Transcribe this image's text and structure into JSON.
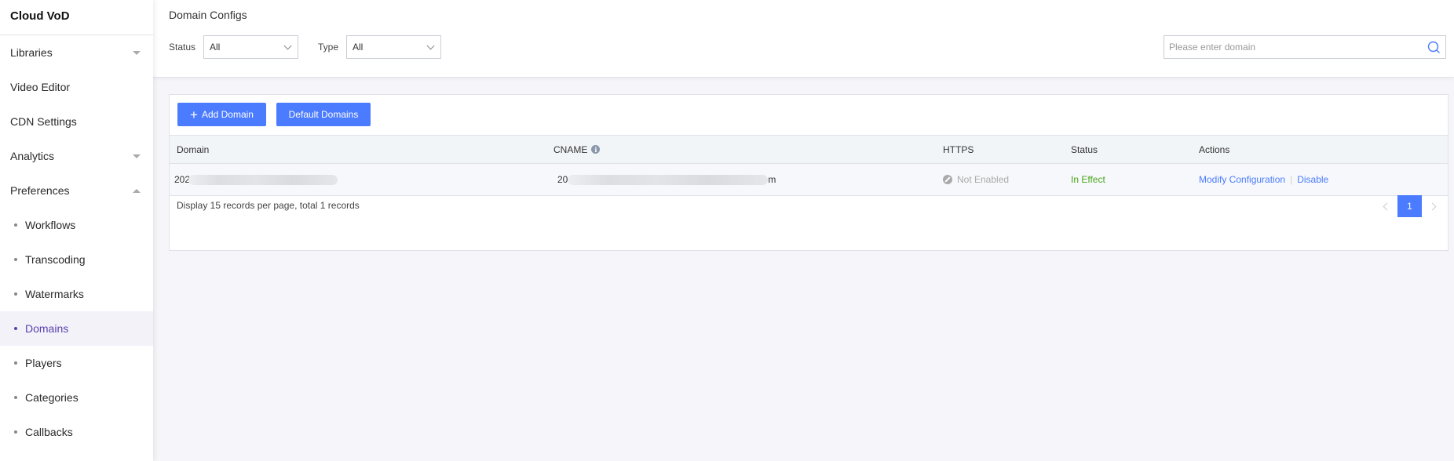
{
  "app": {
    "title": "Cloud VoD"
  },
  "sidebar": {
    "items": [
      {
        "label": "Libraries",
        "caret": "down"
      },
      {
        "label": "Video Editor"
      },
      {
        "label": "CDN Settings"
      },
      {
        "label": "Analytics",
        "caret": "down"
      },
      {
        "label": "Preferences",
        "caret": "up"
      }
    ],
    "sub_items": [
      {
        "label": "Workflows"
      },
      {
        "label": "Transcoding"
      },
      {
        "label": "Watermarks"
      },
      {
        "label": "Domains",
        "active": true
      },
      {
        "label": "Players"
      },
      {
        "label": "Categories"
      },
      {
        "label": "Callbacks"
      }
    ]
  },
  "header": {
    "title": "Domain Configs",
    "filters": {
      "status_label": "Status",
      "status_value": "All",
      "type_label": "Type",
      "type_value": "All"
    },
    "search": {
      "placeholder": "Please enter domain",
      "value": ""
    }
  },
  "toolbar": {
    "add_domain_icon": "plus-icon",
    "add_domain_label": "Add Domain",
    "default_domains_label": "Default Domains"
  },
  "table": {
    "columns": [
      "Domain",
      "CNAME",
      "HTTPS",
      "Status",
      "Actions"
    ],
    "cname_info_icon": "info-icon",
    "rows": [
      {
        "domain_prefix": "202",
        "domain_redacted": true,
        "cname_prefix": "20",
        "cname_suffix": "m",
        "cname_redacted": true,
        "https": "Not Enabled",
        "status": "In Effect",
        "actions": [
          "Modify Configuration",
          "Disable"
        ]
      }
    ]
  },
  "pagination": {
    "summary": "Display 15 records per page, total 1 records",
    "current_page": "1"
  },
  "colors": {
    "primary": "#4b7bff",
    "active_nav": "#5a3fb0",
    "status_effect": "#4aa51a",
    "disabled": "#aaaaaa"
  }
}
